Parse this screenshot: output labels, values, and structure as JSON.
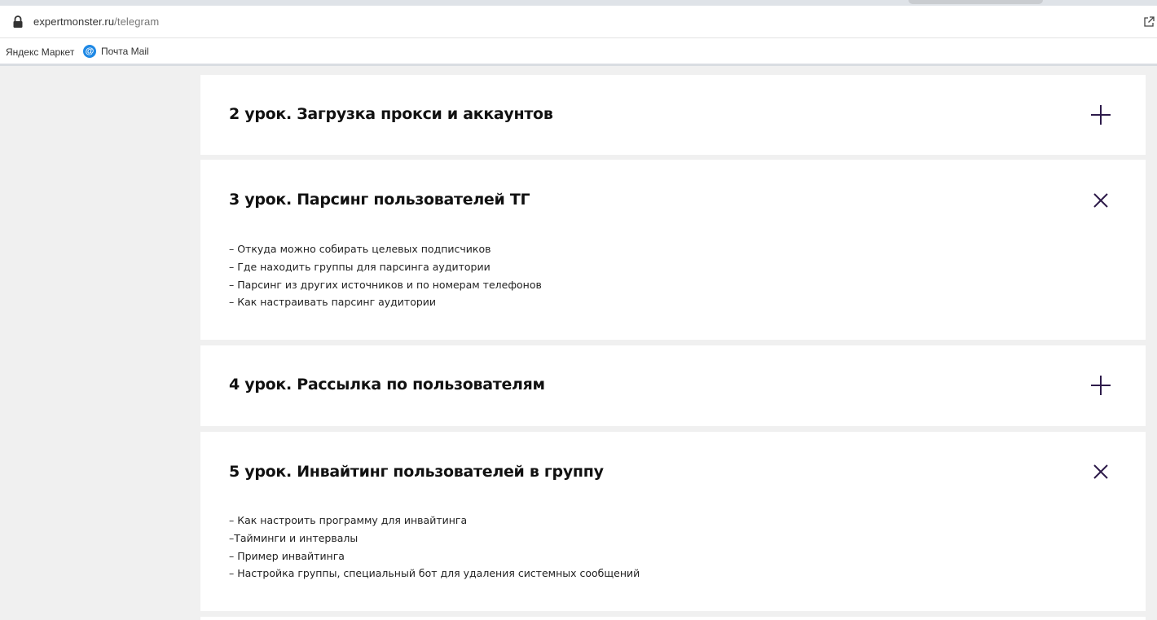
{
  "browser": {
    "url_host": "expertmonster.ru",
    "url_path": "/telegram",
    "bookmarks": [
      {
        "label": "Яндекс Маркет"
      },
      {
        "label": "Почта Mail",
        "icon": "mail-ru-icon",
        "icon_glyph": "@"
      }
    ]
  },
  "colors": {
    "accent": "#2d1a4a",
    "page_bg": "#f0f0f0",
    "card_bg": "#ffffff"
  },
  "lessons": [
    {
      "title": "2 урок. Загрузка прокси и аккаунтов",
      "state": "collapsed",
      "toggle_icon": "plus-icon",
      "items": []
    },
    {
      "title": "3 урок. Парсинг пользователей ТГ",
      "state": "expanded",
      "toggle_icon": "close-icon",
      "items": [
        "– Откуда можно собирать целевых подписчиков",
        "– Где находить группы для парсинга аудитории",
        "– Парсинг из других источников и по номерам телефонов",
        "– Как настраивать парсинг аудитории"
      ]
    },
    {
      "title": "4 урок. Рассылка по пользователям",
      "state": "collapsed",
      "toggle_icon": "plus-icon",
      "items": []
    },
    {
      "title": "5 урок. Инвайтинг пользователей в группу",
      "state": "expanded",
      "toggle_icon": "close-icon",
      "items": [
        "– Как настроить программу для инвайтинга",
        "–Тайминги и интервалы",
        "– Пример инвайтинга",
        "– Настройка группы, специальный бот для удаления системных сообщений"
      ]
    }
  ]
}
